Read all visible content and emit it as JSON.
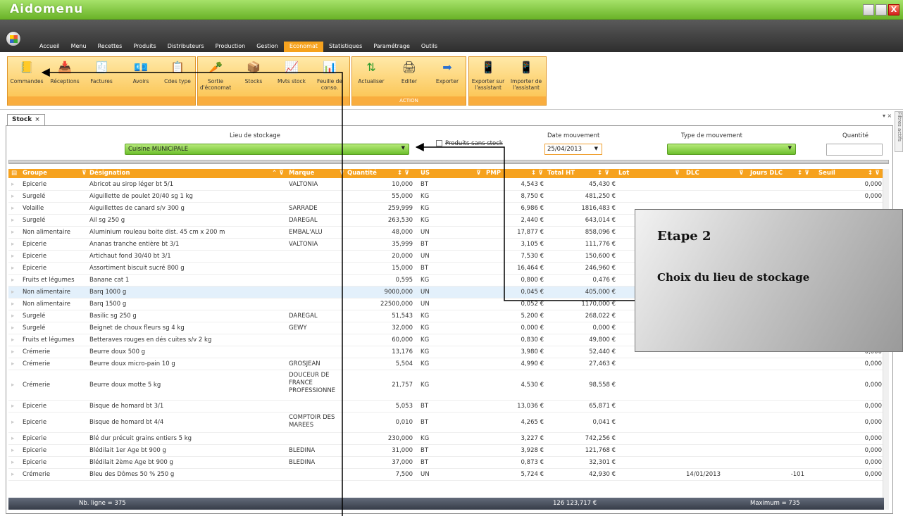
{
  "app": {
    "title": "Aidomenu",
    "close_glyph": "X"
  },
  "menu_tabs": [
    "Accueil",
    "Menu",
    "Recettes",
    "Produits",
    "Distributeurs",
    "Production",
    "Gestion",
    "Economat",
    "Statistiques",
    "Paramétrage",
    "Outils"
  ],
  "ribbon": {
    "btn_commandes": "Commandes",
    "btn_receptions": "Réceptions",
    "btn_factures": "Factures",
    "btn_avoirs": "Avoirs",
    "btn_cdes": "Cdes type",
    "btn_sortie": "Sortie d'économat",
    "btn_stocks": "Stocks",
    "btn_mvts": "Mvts stock",
    "btn_feuille": "Feuille de conso.",
    "btn_actualiser": "Actualiser",
    "btn_editer": "Editer",
    "btn_exporter": "Exporter",
    "action_label": "ACTION",
    "btn_exp_assistant": "Exporter sur l'assistant",
    "btn_imp_assistant": "Importer de l'assistant"
  },
  "doc_tab": {
    "label": "Stock",
    "close": "×"
  },
  "side_panel": {
    "filtres": "Filtres actifs",
    "controls": "▾ ×"
  },
  "filters": {
    "lieu_label": "Lieu de stockage",
    "lieu_value": "Cuisine MUNICIPALE",
    "sans_stock_label": "Produits sans stock",
    "date_label": "Date mouvement",
    "date_value": "25/04/2013",
    "type_label": "Type de mouvement",
    "quantite_label": "Quantité"
  },
  "columns": [
    "Groupe",
    "Désignation",
    "Marque",
    "Quantité",
    "US",
    "PMP",
    "Total HT",
    "Lot",
    "DLC",
    "Jours DLC",
    "Seuil"
  ],
  "rows": [
    [
      "Epicerie",
      "Abricot au sirop léger bt 5/1",
      "VALTONIA",
      "10,000",
      "BT",
      "4,543 €",
      "45,430 €",
      "",
      "",
      "",
      "0,000"
    ],
    [
      "Surgelé",
      "Aiguillette de poulet 20/40 sg 1 kg",
      "",
      "55,000",
      "KG",
      "8,750 €",
      "481,250 €",
      "",
      "",
      "",
      "0,000"
    ],
    [
      "Volaille",
      "Aiguillettes de canard s/v 300 g",
      "SARRADE",
      "259,999",
      "KG",
      "6,986 €",
      "1816,483 €",
      "",
      "",
      "",
      ""
    ],
    [
      "Surgelé",
      "Ail sg 250 g",
      "DAREGAL",
      "263,530",
      "KG",
      "2,440 €",
      "643,014 €",
      "",
      "",
      "",
      ""
    ],
    [
      "Non alimentaire",
      "Aluminium rouleau boite dist. 45 cm x 200 m",
      "EMBAL'ALU",
      "48,000",
      "UN",
      "17,877 €",
      "858,096 €",
      "",
      "",
      "",
      ""
    ],
    [
      "Epicerie",
      "Ananas tranche entière bt 3/1",
      "VALTONIA",
      "35,999",
      "BT",
      "3,105 €",
      "111,776 €",
      "",
      "",
      "",
      ""
    ],
    [
      "Epicerie",
      "Artichaut fond 30/40 bt 3/1",
      "",
      "20,000",
      "UN",
      "7,530 €",
      "150,600 €",
      "",
      "",
      "",
      ""
    ],
    [
      "Epicerie",
      "Assortiment biscuit sucré 800 g",
      "",
      "15,000",
      "BT",
      "16,464 €",
      "246,960 €",
      "",
      "",
      "",
      ""
    ],
    [
      "Fruits et légumes",
      "Banane cat 1",
      "",
      "0,595",
      "KG",
      "0,800 €",
      "0,476 €",
      "",
      "",
      "",
      ""
    ],
    [
      "Non alimentaire",
      "Barq 1000 g",
      "",
      "9000,000",
      "UN",
      "0,045 €",
      "405,000 €",
      "",
      "",
      "",
      ""
    ],
    [
      "Non alimentaire",
      "Barq 1500 g",
      "",
      "22500,000",
      "UN",
      "0,052 €",
      "1170,000 €",
      "",
      "",
      "",
      ""
    ],
    [
      "Surgelé",
      "Basilic sg 250 g",
      "DAREGAL",
      "51,543",
      "KG",
      "5,200 €",
      "268,022 €",
      "",
      "",
      "",
      ""
    ],
    [
      "Surgelé",
      "Beignet de choux fleurs sg 4 kg",
      "GEWY",
      "32,000",
      "KG",
      "0,000 €",
      "0,000 €",
      "",
      "",
      "",
      ""
    ],
    [
      "Fruits et légumes",
      "Betteraves rouges en dés cuites s/v 2 kg",
      "",
      "60,000",
      "KG",
      "0,830 €",
      "49,800 €",
      "",
      "",
      "",
      ""
    ],
    [
      "Crémerie",
      "Beurre doux 500 g",
      "",
      "13,176",
      "KG",
      "3,980 €",
      "52,440 €",
      "",
      "",
      "",
      "0,000"
    ],
    [
      "Crémerie",
      "Beurre doux micro-pain 10 g",
      "GROSJEAN",
      "5,504",
      "KG",
      "4,990 €",
      "27,463 €",
      "",
      "",
      "",
      "0,000"
    ],
    [
      "Crémerie",
      "Beurre doux motte 5 kg",
      "DOUCEUR DE FRANCE PROFESSIONNE",
      "21,757",
      "KG",
      "4,530 €",
      "98,558 €",
      "",
      "",
      "",
      "0,000"
    ],
    [
      "Epicerie",
      "Bisque de homard bt 3/1",
      "",
      "5,053",
      "BT",
      "13,036 €",
      "65,871 €",
      "",
      "",
      "",
      "0,000"
    ],
    [
      "Epicerie",
      "Bisque de homard bt 4/4",
      "COMPTOIR DES MAREES",
      "0,010",
      "BT",
      "4,265 €",
      "0,041 €",
      "",
      "",
      "",
      "0,000"
    ],
    [
      "Epicerie",
      "Blé dur précuit grains entiers 5 kg",
      "",
      "230,000",
      "KG",
      "3,227 €",
      "742,256 €",
      "",
      "",
      "",
      "0,000"
    ],
    [
      "Epicerie",
      "Blédilait 1er Age bt 900 g",
      "BLEDINA",
      "31,000",
      "BT",
      "3,928 €",
      "121,768 €",
      "",
      "",
      "",
      "0,000"
    ],
    [
      "Epicerie",
      "Blédilait 2ème Age bt 900 g",
      "BLEDINA",
      "37,000",
      "BT",
      "0,873 €",
      "32,301 €",
      "",
      "",
      "",
      "0,000"
    ],
    [
      "Crémerie",
      "Bleu des Dômes 50 % 250 g",
      "",
      "7,500",
      "UN",
      "5,724 €",
      "42,930 €",
      "",
      "14/01/2013",
      "-101",
      "0,000"
    ]
  ],
  "footer": {
    "nb_lignes": "Nb. ligne = 375",
    "total": "126 123,717 €",
    "maximum": "Maximum = 735"
  },
  "callout": {
    "title": "Etape 2",
    "subtitle": "Choix du lieu de stockage"
  }
}
